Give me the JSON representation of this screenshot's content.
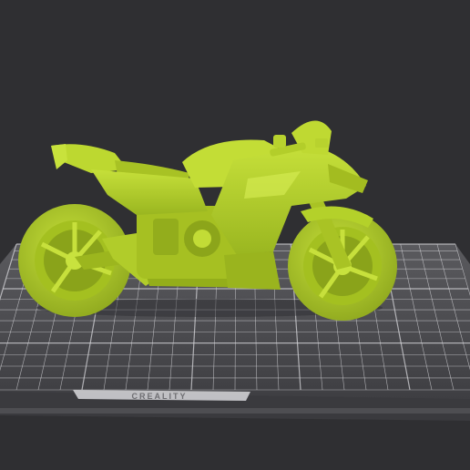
{
  "viewport": {
    "background": "#2f2f32"
  },
  "build_plate": {
    "brand_label": "CREALITY",
    "surface_color": "#4a4a4e",
    "grid_color": "#d6d6da",
    "edge_color": "#3c3c40"
  },
  "model": {
    "name_icon": "motorcycle-model",
    "color": "#b4d12a",
    "shadow_color": "#7e9418",
    "highlight_color": "#d2ea4a"
  }
}
